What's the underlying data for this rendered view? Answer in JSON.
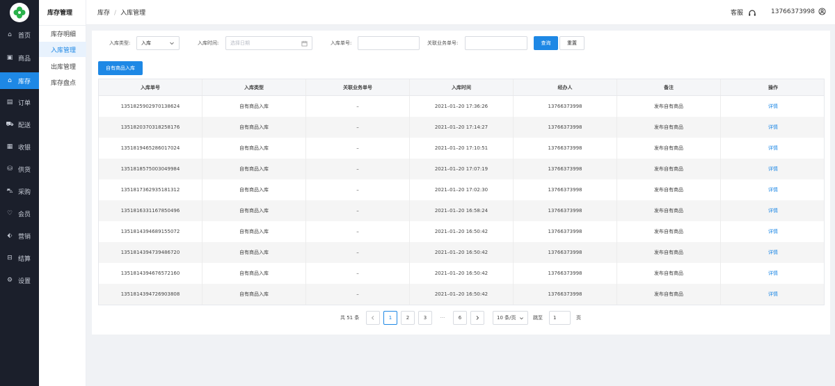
{
  "nav": {
    "items": [
      {
        "icon": "home-icon",
        "label": "首页"
      },
      {
        "icon": "goods-icon",
        "label": "商品"
      },
      {
        "icon": "warehouse-icon",
        "label": "库存"
      },
      {
        "icon": "order-icon",
        "label": "订单"
      },
      {
        "icon": "delivery-icon",
        "label": "配送"
      },
      {
        "icon": "cashier-icon",
        "label": "收银"
      },
      {
        "icon": "supply-icon",
        "label": "供货"
      },
      {
        "icon": "cart-icon",
        "label": "采购"
      },
      {
        "icon": "member-icon",
        "label": "会员"
      },
      {
        "icon": "tag-icon",
        "label": "营销"
      },
      {
        "icon": "settle-icon",
        "label": "结算"
      },
      {
        "icon": "gear-icon",
        "label": "设置"
      }
    ],
    "active_index": 2
  },
  "submenu": {
    "title": "库存管理",
    "items": [
      "库存明细",
      "入库管理",
      "出库管理",
      "库存盘点"
    ],
    "active_index": 1
  },
  "header": {
    "breadcrumb": [
      "库存",
      "入库管理"
    ],
    "service_label": "客服",
    "user_phone": "13766373998"
  },
  "filters": {
    "type_label": "入库类型:",
    "type_value": "入库",
    "time_label": "入库时间:",
    "time_placeholder": "选择日期",
    "no_label": "入库单号:",
    "no_value": "",
    "related_label": "关联业务单号:",
    "related_value": "",
    "search_button": "查询",
    "reset_button": "重置"
  },
  "add_button": "自有商品入库",
  "table": {
    "columns": [
      "入库单号",
      "入库类型",
      "关联业务单号",
      "入库时间",
      "经办人",
      "备注",
      "操作"
    ],
    "rows": [
      [
        "1351825902970138624",
        "自有商品入库",
        "–",
        "2021–01–20 17:36:26",
        "13766373998",
        "发布自有商品",
        "详情"
      ],
      [
        "1351820370318258176",
        "自有商品入库",
        "–",
        "2021–01–20 17:14:27",
        "13766373998",
        "发布自有商品",
        "详情"
      ],
      [
        "1351819465286017024",
        "自有商品入库",
        "–",
        "2021–01–20 17:10:51",
        "13766373998",
        "发布自有商品",
        "详情"
      ],
      [
        "1351818575003049984",
        "自有商品入库",
        "–",
        "2021–01–20 17:07:19",
        "13766373998",
        "发布自有商品",
        "详情"
      ],
      [
        "1351817362935181312",
        "自有商品入库",
        "–",
        "2021–01–20 17:02:30",
        "13766373998",
        "发布自有商品",
        "详情"
      ],
      [
        "1351816331167850496",
        "自有商品入库",
        "–",
        "2021–01–20 16:58:24",
        "13766373998",
        "发布自有商品",
        "详情"
      ],
      [
        "1351814394689155072",
        "自有商品入库",
        "–",
        "2021–01–20 16:50:42",
        "13766373998",
        "发布自有商品",
        "详情"
      ],
      [
        "1351814394739486720",
        "自有商品入库",
        "–",
        "2021–01–20 16:50:42",
        "13766373998",
        "发布自有商品",
        "详情"
      ],
      [
        "1351814394676572160",
        "自有商品入库",
        "–",
        "2021–01–20 16:50:42",
        "13766373998",
        "发布自有商品",
        "详情"
      ],
      [
        "1351814394726903808",
        "自有商品入库",
        "–",
        "2021–01–20 16:50:42",
        "13766373998",
        "发布自有商品",
        "详情"
      ]
    ]
  },
  "pagination": {
    "total_text": "共 51 条",
    "pages": [
      "1",
      "2",
      "3"
    ],
    "ellipsis": "···",
    "last_page": "6",
    "current_page": "1",
    "page_size": "10 条/页",
    "jump_label": "跳至",
    "jump_value": "1",
    "page_unit": "页"
  },
  "colors": {
    "accent": "#1e88e5",
    "sidebar_bg": "#1b1f2b",
    "logo": "#2bb24c"
  }
}
